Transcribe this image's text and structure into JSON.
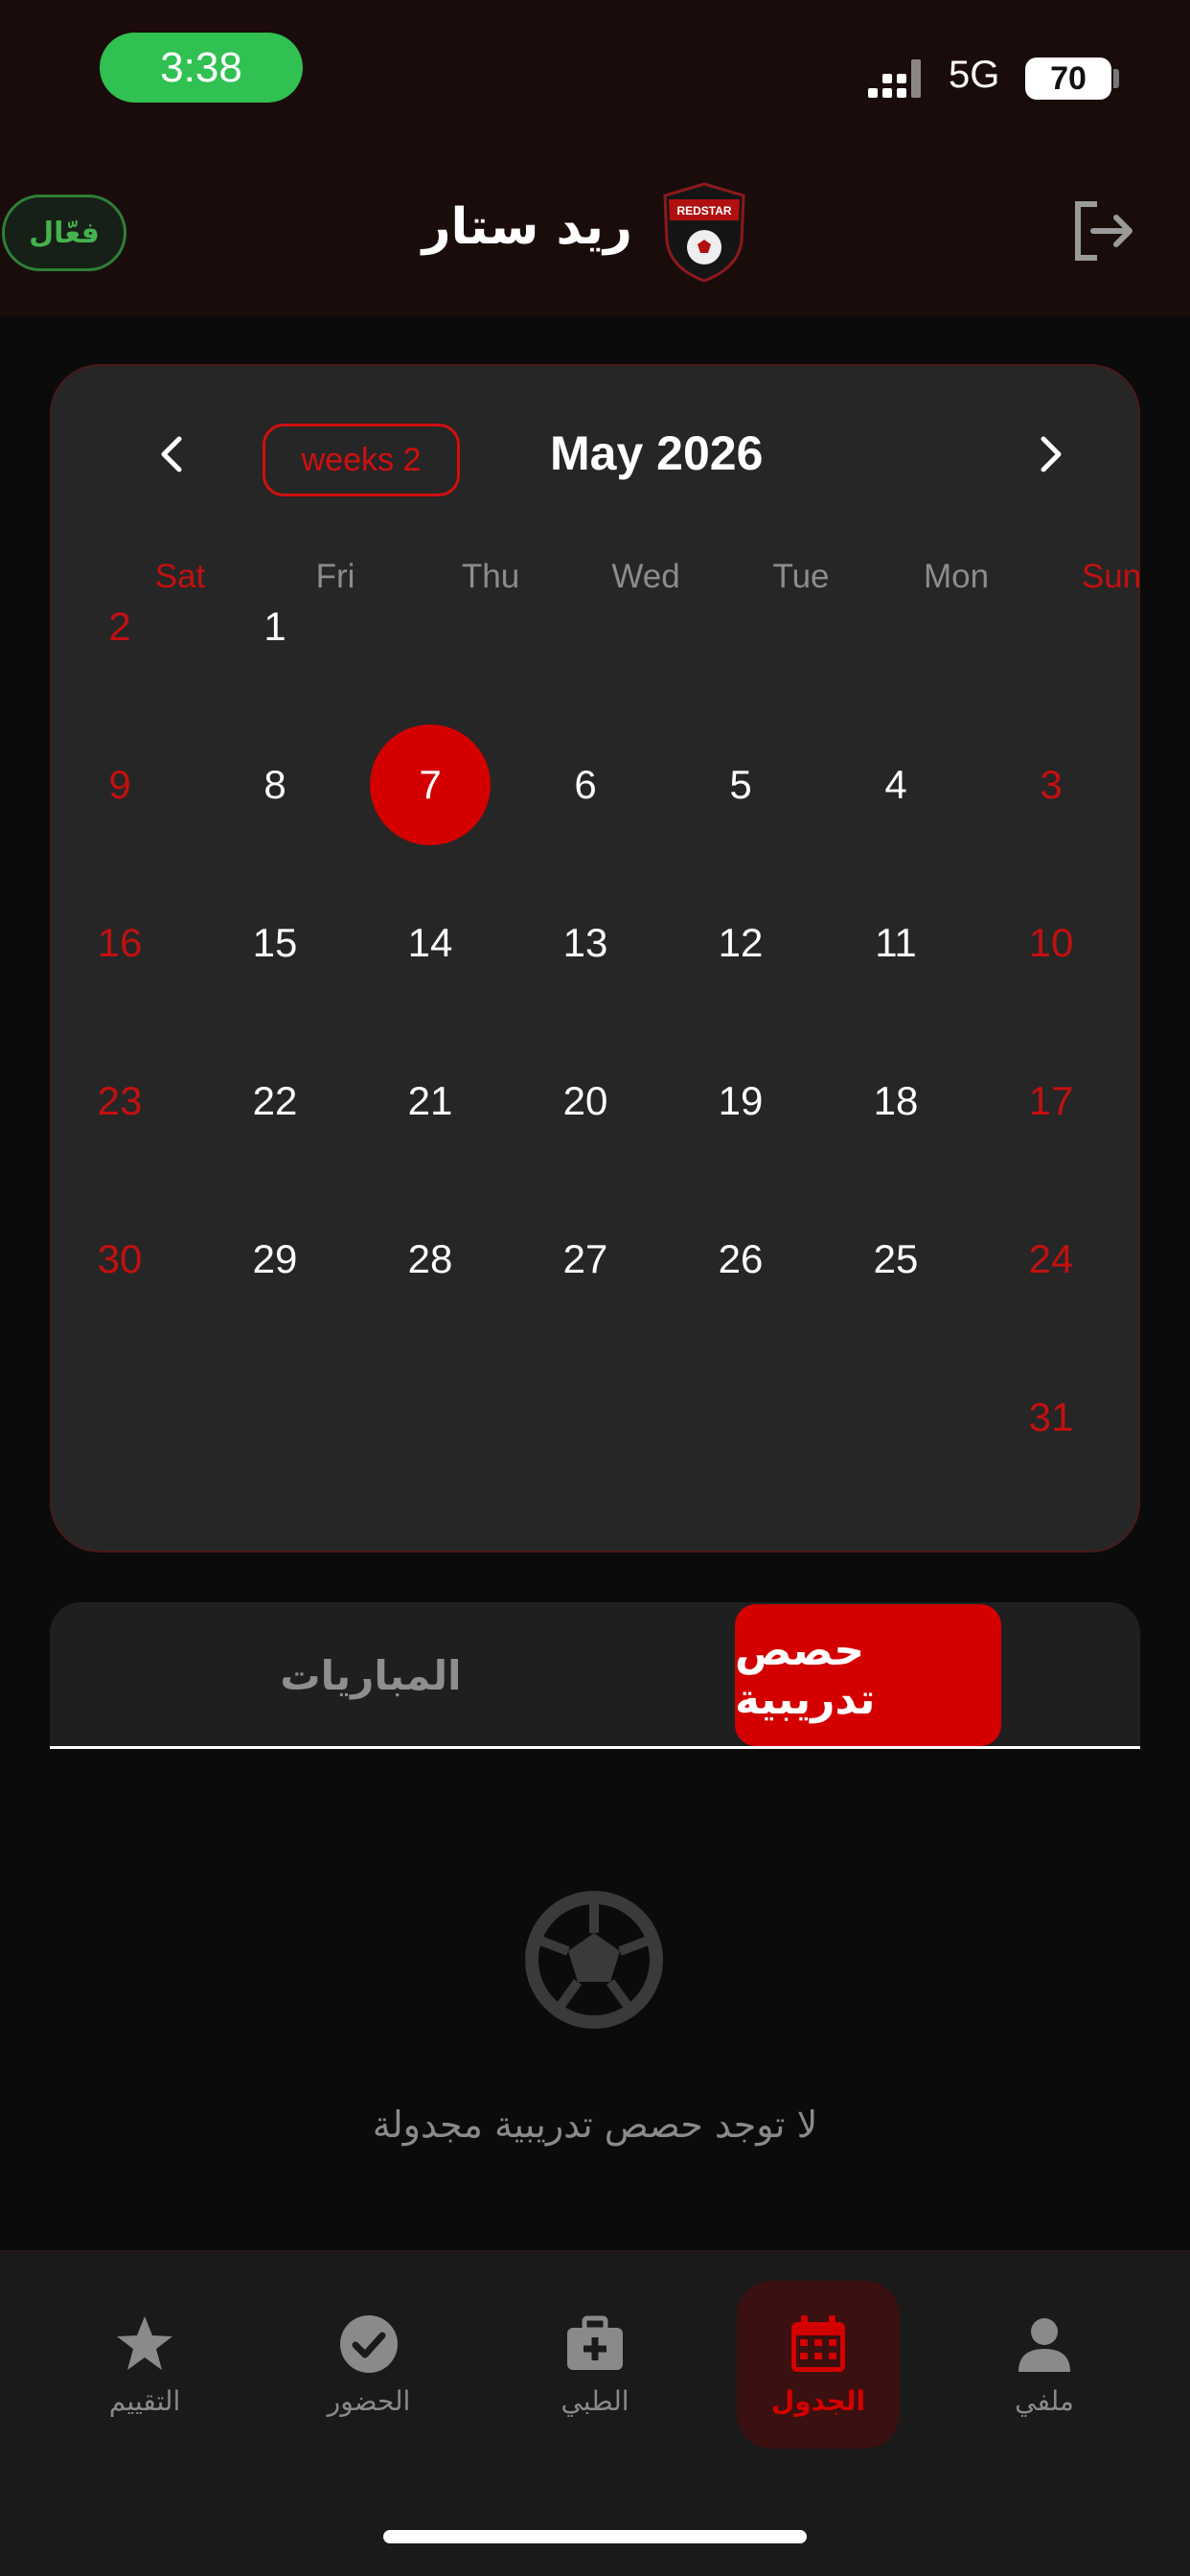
{
  "status_bar": {
    "time": "3:38",
    "network": "5G",
    "battery": "70"
  },
  "header": {
    "status_badge": "فعّال",
    "club_name": "ريد ستار",
    "logo_text": "REDSTAR"
  },
  "calendar": {
    "prev_icon": "chevron-left-icon",
    "next_icon": "chevron-right-icon",
    "weeks_label": "weeks 2",
    "month_title": "May 2026",
    "weekdays": [
      "Sat",
      "Fri",
      "Thu",
      "Wed",
      "Tue",
      "Mon",
      "Sun"
    ],
    "weekend_color": "#c21010",
    "today": "7",
    "today_color": "#d40000",
    "rows": [
      [
        "2",
        "1",
        "",
        "",
        "",
        "",
        ""
      ],
      [
        "9",
        "8",
        "7",
        "6",
        "5",
        "4",
        "3"
      ],
      [
        "16",
        "15",
        "14",
        "13",
        "12",
        "11",
        "10"
      ],
      [
        "23",
        "22",
        "21",
        "20",
        "19",
        "18",
        "17"
      ],
      [
        "30",
        "29",
        "28",
        "27",
        "26",
        "25",
        "24"
      ],
      [
        "",
        "",
        "",
        "",
        "",
        "",
        "31"
      ]
    ]
  },
  "tabs": {
    "active": "حصص تدريبية",
    "inactive": "المباريات"
  },
  "empty_state": {
    "icon": "soccer-ball-icon",
    "message": "لا توجد حصص تدريبية مجدولة"
  },
  "bottom_nav": {
    "items": [
      {
        "label": "التقييم",
        "icon": "star-icon"
      },
      {
        "label": "الحضور",
        "icon": "check-circle-icon"
      },
      {
        "label": "الطبي",
        "icon": "medical-kit-icon"
      },
      {
        "label": "الجدول",
        "icon": "calendar-icon",
        "active": true
      },
      {
        "label": "ملفي",
        "icon": "person-icon"
      }
    ]
  }
}
